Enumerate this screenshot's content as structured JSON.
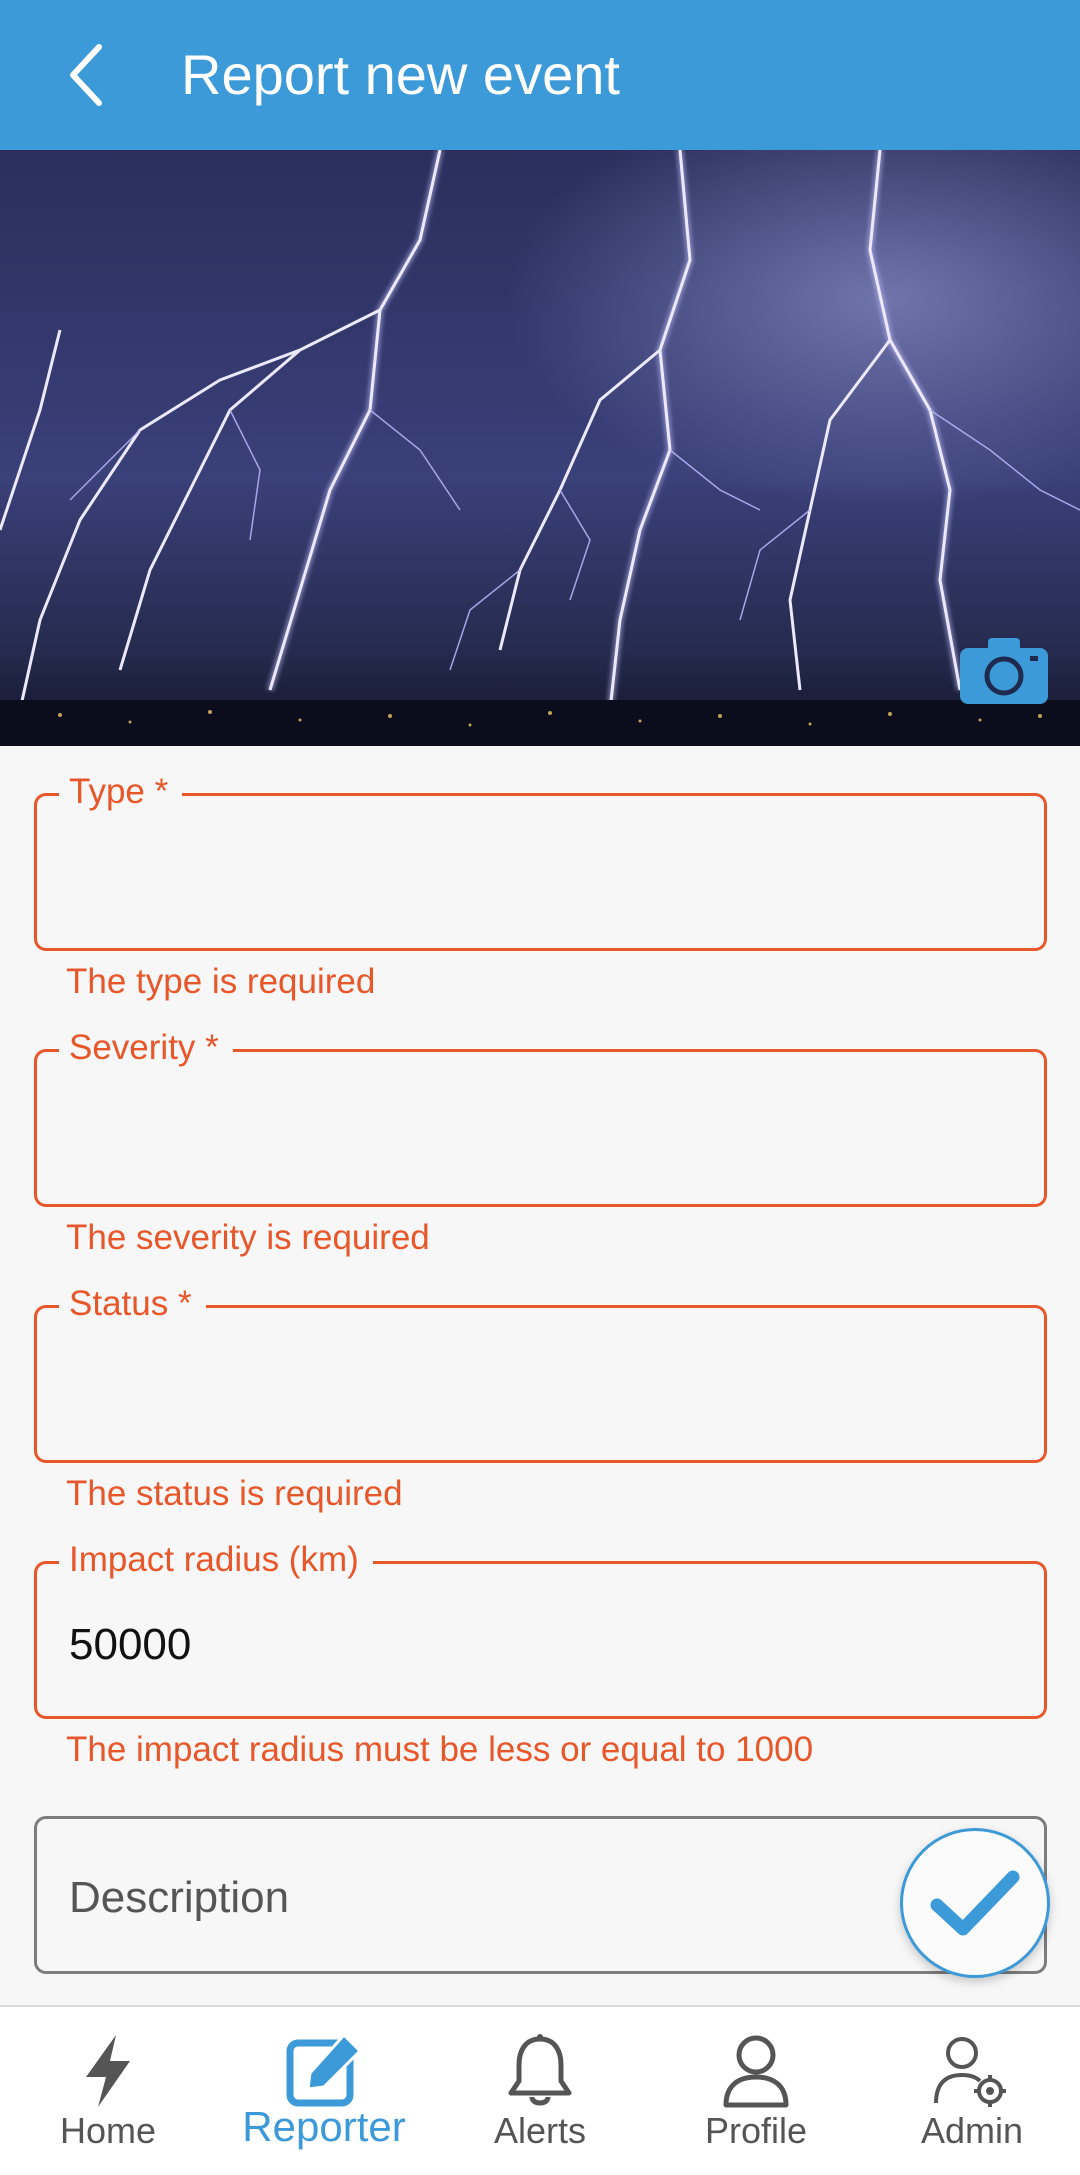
{
  "appbar": {
    "title": "Report new event",
    "back_icon": "chevron-left-icon"
  },
  "hero": {
    "image": "lightning storm photo",
    "camera_icon": "camera-icon"
  },
  "form": {
    "type": {
      "label": "Type *",
      "value": "",
      "error": "The type is required"
    },
    "severity": {
      "label": "Severity *",
      "value": "",
      "error": "The severity is required"
    },
    "status": {
      "label": "Status *",
      "value": "",
      "error": "The status is required"
    },
    "impact_radius": {
      "label": "Impact radius (km)",
      "value": "50000",
      "error": "The impact radius must be less or equal to 1000"
    },
    "description": {
      "placeholder": "Description",
      "value": ""
    }
  },
  "fab": {
    "icon": "check-icon"
  },
  "bottom_nav": {
    "items": [
      {
        "label": "Home",
        "icon": "lightning-icon"
      },
      {
        "label": "Reporter",
        "icon": "edit-icon",
        "active": true
      },
      {
        "label": "Alerts",
        "icon": "bell-icon"
      },
      {
        "label": "Profile",
        "icon": "person-icon"
      },
      {
        "label": "Admin",
        "icon": "admin-icon"
      }
    ]
  },
  "colors": {
    "primary": "#3d9ad8",
    "error": "#e8572a",
    "background": "#f7f7f7"
  }
}
